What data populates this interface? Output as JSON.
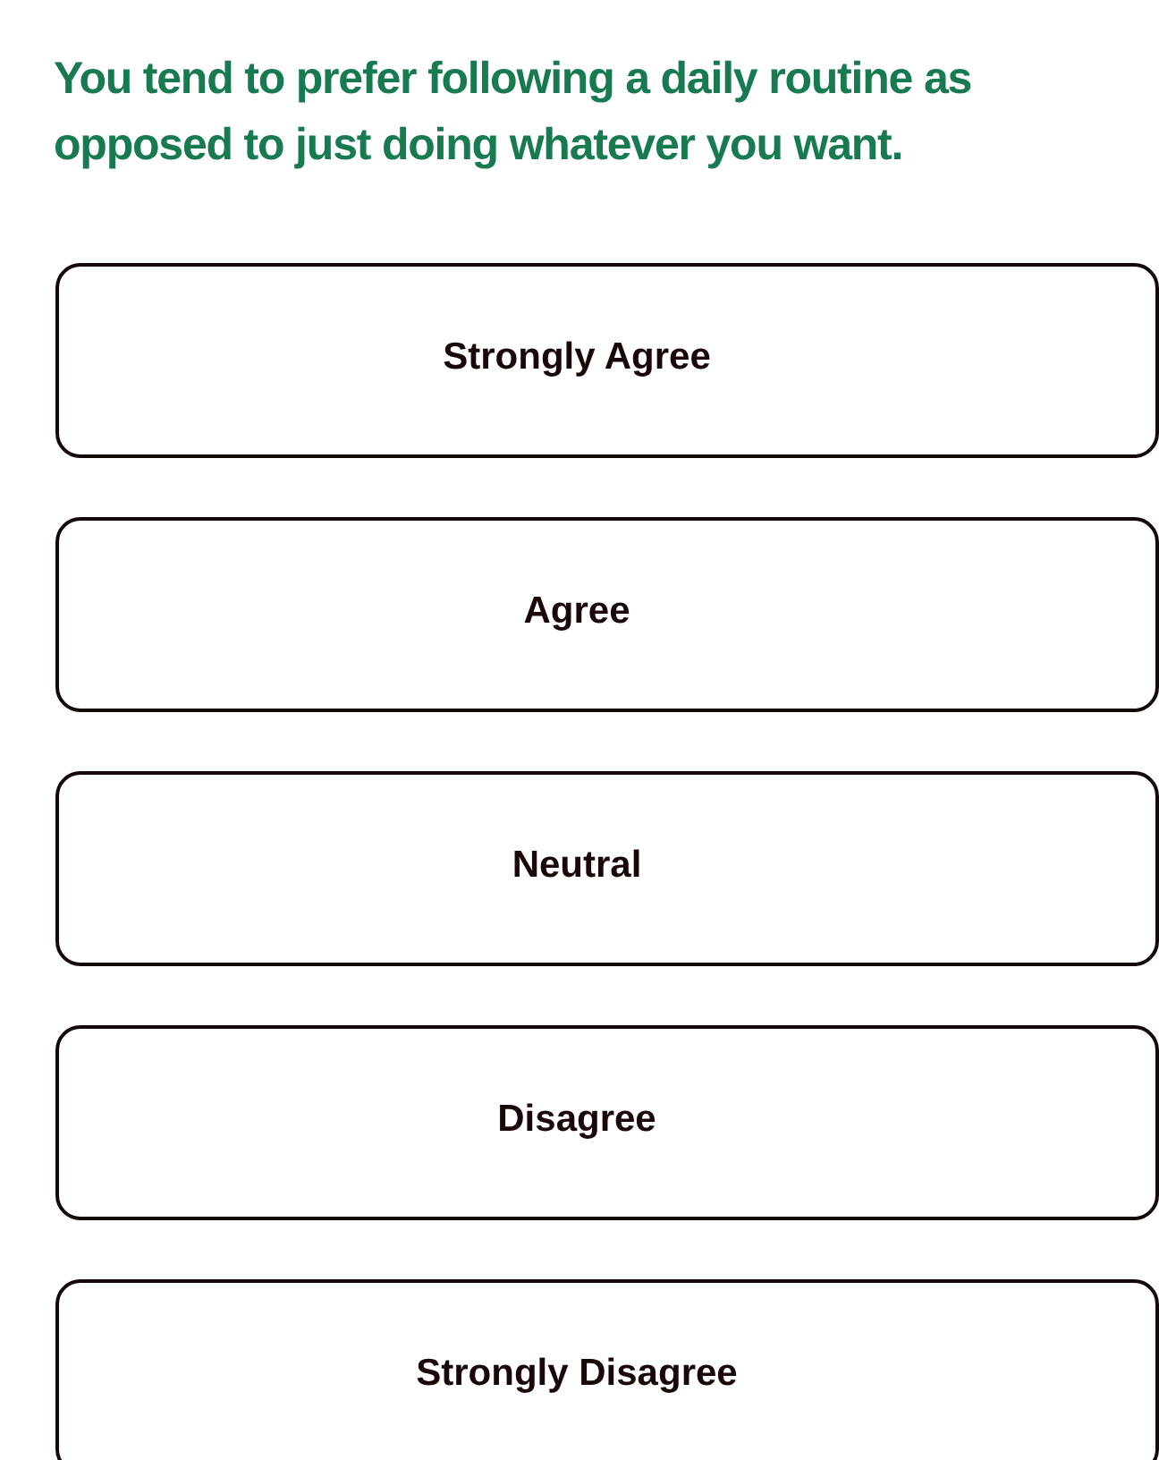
{
  "question": "You tend to prefer following a daily routine as opposed to just doing whatever you want.",
  "options": [
    {
      "label": "Strongly Agree",
      "selected": false
    },
    {
      "label": "Agree",
      "selected": false
    },
    {
      "label": "Neutral",
      "selected": false
    },
    {
      "label": "Disagree",
      "selected": false
    },
    {
      "label": "Strongly Disagree",
      "selected": false
    }
  ]
}
